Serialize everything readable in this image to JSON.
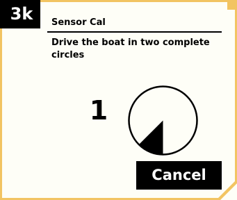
{
  "step": {
    "label": "3k"
  },
  "screen": {
    "title": "Sensor Cal",
    "instruction": "Drive the boat in two complete circles"
  },
  "progress": {
    "circle_count": "1",
    "current_circle_fraction": 0.125
  },
  "actions": {
    "cancel_label": "Cancel"
  },
  "colors": {
    "accent": "#f2c462",
    "background": "#fefef7",
    "foreground": "#000000"
  }
}
